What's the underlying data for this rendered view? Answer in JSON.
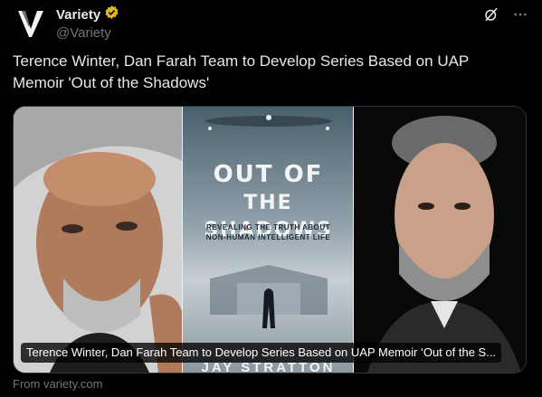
{
  "post": {
    "author_name": "Variety",
    "handle": "@Variety",
    "verified": true,
    "text": "Terence Winter, Dan Farah Team to Develop Series Based on UAP Memoir 'Out of the Shadows'"
  },
  "icons": {
    "avatar_logo": "variety-v-logo",
    "verified": "verified-badge-icon",
    "grok": "grok-icon",
    "more": "more-options-icon"
  },
  "card": {
    "caption": "Terence Winter, Dan Farah Team to Develop Series Based on UAP Memoir ‘Out of the S...",
    "source": "From variety.com",
    "book": {
      "title_line1": "OUT OF",
      "title_line2": "THE SHADOWS",
      "subtitle_line1": "REVEALING THE TRUTH ABOUT",
      "subtitle_line2": "NON-HUMAN INTELLIGENT LIFE",
      "author": "JAY STRATTON"
    }
  },
  "colors": {
    "background": "#000000",
    "text_primary": "#e7e9ea",
    "text_secondary": "#71767b",
    "verified_gold": "#e2b719",
    "border": "#2f3336"
  }
}
